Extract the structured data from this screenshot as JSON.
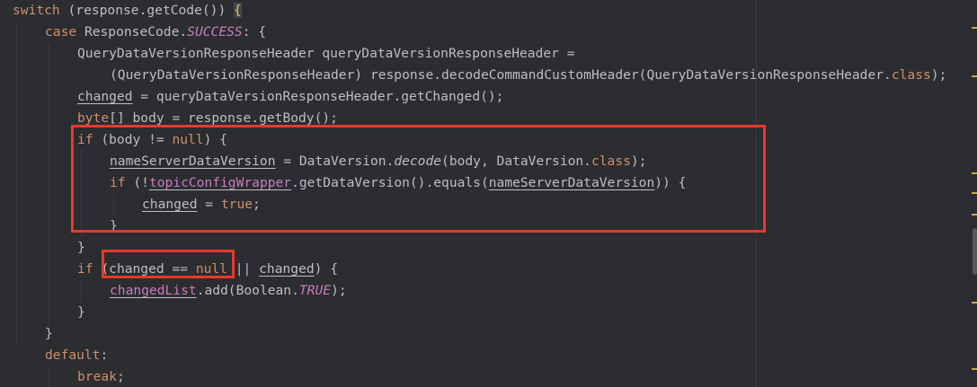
{
  "lines": {
    "l1": {
      "kw_switch": "switch",
      "rest": " (response.getCode()) ",
      "brace": "{"
    },
    "l2": {
      "kw_case": "case",
      "rest": " ResponseCode.",
      "success": "SUCCESS",
      "colon": ":",
      "brace": " {"
    },
    "l3": {
      "text": "QueryDataVersionResponseHeader queryDataVersionResponseHeader ="
    },
    "l4": {
      "text_a": "(QueryDataVersionResponseHeader) response.decodeCommandCustomHeader(QueryDataVersionResponseHeader.",
      "kw_class": "class",
      "text_b": ");"
    },
    "l5": {
      "var": "changed",
      "text": " = queryDataVersionResponseHeader.getChanged();"
    },
    "l6": {
      "kw_byte": "byte",
      "text": "[] body = response.getBody();"
    },
    "l7": {
      "kw_if": "if",
      "text_a": " (body != ",
      "kw_null": "null",
      "text_b": ") {"
    },
    "l8": {
      "var": "nameServerDataVersion",
      "text_a": " = DataVersion.",
      "method": "decode",
      "text_b": "(body, DataVersion.",
      "kw_class": "class",
      "text_c": ");"
    },
    "l9": {
      "kw_if": "if",
      "text_a": " (!",
      "var_a": "topicConfigWrapper",
      "text_b": ".getDataVersion().equals(",
      "var_b": "nameServerDataVersion",
      "text_c": ")) {"
    },
    "l10": {
      "var": "changed",
      "text_a": " = ",
      "kw_true": "true",
      "text_b": ";"
    },
    "l11": {
      "text": "}"
    },
    "l12": {
      "text": "}"
    },
    "l13": {
      "kw_if": "if",
      "text_a": " (",
      "var_a": "changed",
      "text_b": " == ",
      "kw_null": "null",
      "text_c": " || ",
      "var_b": "changed",
      "text_d": ") {"
    },
    "l14": {
      "var": "changedList",
      "text_a": ".add(Boolean.",
      "const": "TRUE",
      "text_b": ");"
    },
    "l15": {
      "text": "}"
    },
    "l16": {
      "text": "}"
    },
    "l17": {
      "kw_default": "default",
      "text": ":"
    },
    "l18": {
      "kw_break": "break",
      "text": ";"
    }
  },
  "colors": {
    "background": "#2b2d30",
    "keyword": "#cf8e6d",
    "text": "#bcbec4",
    "field": "#c77dbb",
    "highlight_box": "#e8392b"
  }
}
